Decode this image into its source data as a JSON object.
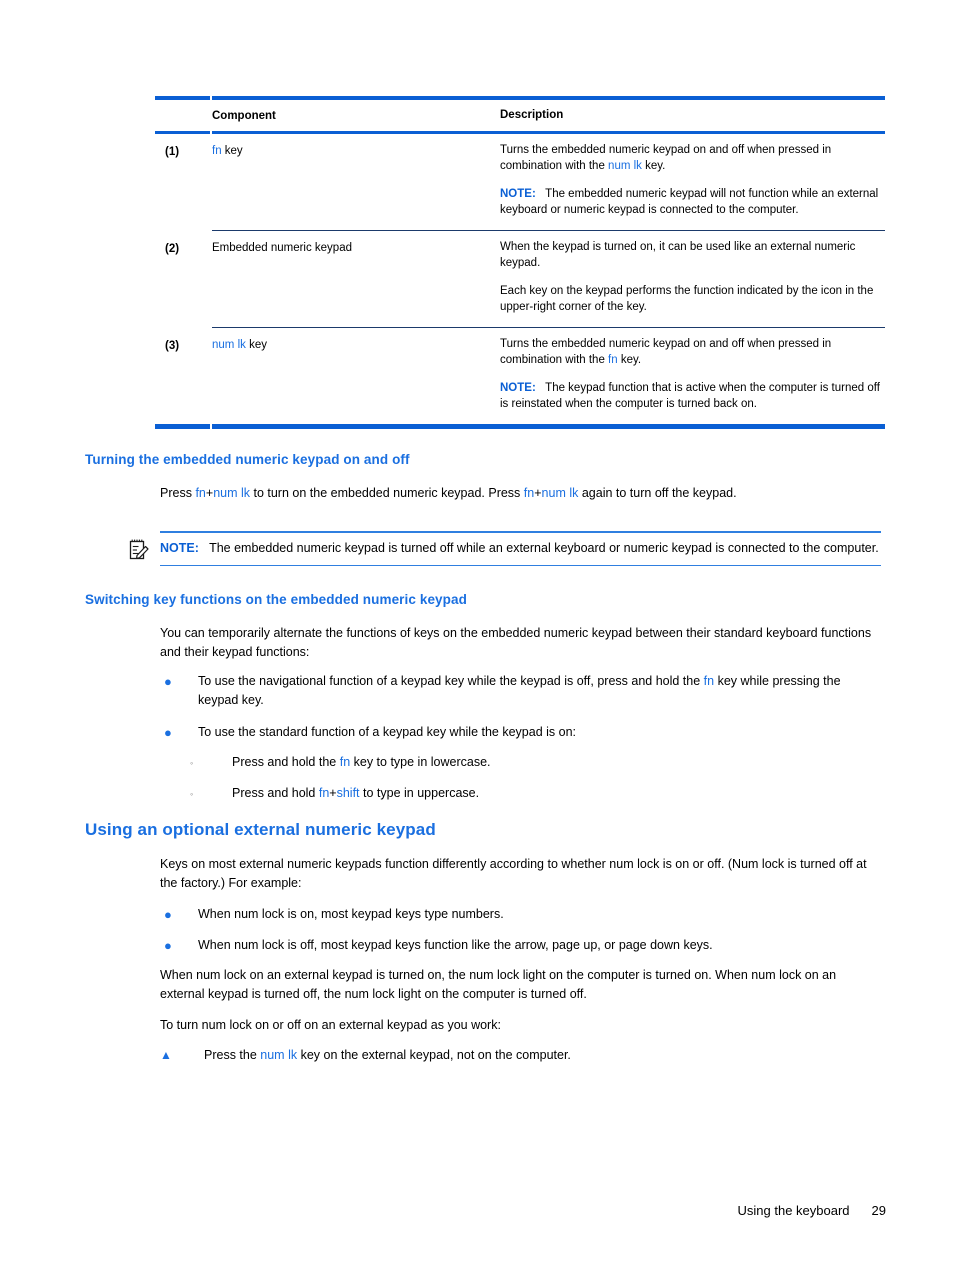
{
  "table": {
    "headers": {
      "component": "Component",
      "description": "Description"
    },
    "rows": [
      {
        "num": "(1)",
        "component_pre": "",
        "component_kw": "fn",
        "component_post": " key",
        "desc_paras": [
          {
            "pre": "Turns the embedded numeric keypad on and off when pressed in combination with the ",
            "kw": "num lk",
            "post": " key."
          }
        ],
        "note_label": "NOTE:",
        "note_text": "The embedded numeric keypad will not function while an external keyboard or numeric keypad is connected to the computer."
      },
      {
        "num": "(2)",
        "component_pre": "Embedded numeric keypad",
        "component_kw": "",
        "component_post": "",
        "desc_paras": [
          {
            "pre": "When the keypad is turned on, it can be used like an external numeric keypad.",
            "kw": "",
            "post": ""
          },
          {
            "pre": "Each key on the keypad performs the function indicated by the icon in the upper-right corner of the key.",
            "kw": "",
            "post": ""
          }
        ],
        "note_label": "",
        "note_text": ""
      },
      {
        "num": "(3)",
        "component_pre": "",
        "component_kw": "num lk",
        "component_post": " key",
        "desc_paras": [
          {
            "pre": "Turns the embedded numeric keypad on and off when pressed in combination with the ",
            "kw": "fn",
            "post": " key."
          }
        ],
        "note_label": "NOTE:",
        "note_text": "The keypad function that is active when the computer is turned off is reinstated when the computer is turned back on."
      }
    ]
  },
  "section_turning": {
    "heading": "Turning the embedded numeric keypad on and off",
    "para": {
      "t1": "Press ",
      "kw1": "fn",
      "plus1": "+",
      "kw2": "num lk",
      "t2": " to turn on the embedded numeric keypad. Press ",
      "kw3": "fn",
      "plus2": "+",
      "kw4": "num lk",
      "t3": " again to turn off the keypad."
    },
    "note": {
      "label": "NOTE:",
      "text": "The embedded numeric keypad is turned off while an external keyboard or numeric keypad is connected to the computer.",
      "icon": "note-pencil-icon"
    }
  },
  "section_switching": {
    "heading": "Switching key functions on the embedded numeric keypad",
    "intro": "You can temporarily alternate the functions of keys on the embedded numeric keypad between their standard keyboard functions and their keypad functions:",
    "bullet_glyph": "●",
    "subbullet_glyph": "◦",
    "bullets": [
      {
        "pre": "To use the navigational function of a keypad key while the keypad is off, press and hold the ",
        "kw": "fn",
        "post": " key while pressing the keypad key."
      },
      {
        "pre": "To use the standard function of a keypad key while the keypad is on:",
        "kw": "",
        "post": ""
      }
    ],
    "subbullets": [
      {
        "pre": "Press and hold the ",
        "kw": "fn",
        "mid": "",
        "kw2": "",
        "post": " key to type in lowercase."
      },
      {
        "pre": "Press and hold ",
        "kw": "fn",
        "mid": "+",
        "kw2": "shift",
        "post": " to type in uppercase."
      }
    ]
  },
  "section_external": {
    "heading": "Using an optional external numeric keypad",
    "intro": "Keys on most external numeric keypads function differently according to whether num lock is on or off. (Num lock is turned off at the factory.) For example:",
    "bullets": [
      "When num lock is on, most keypad keys type numbers.",
      "When num lock is off, most keypad keys function like the arrow, page up, or page down keys."
    ],
    "para2": "When num lock on an external keypad is turned on, the num lock light on the computer is turned on. When num lock on an external keypad is turned off, the num lock light on the computer is turned off.",
    "para3": "To turn num lock on or off on an external keypad as you work:",
    "triangle_glyph": "▲",
    "final": {
      "pre": "Press the ",
      "kw": "num lk",
      "post": " key on the external keypad, not on the computer."
    }
  },
  "footer": {
    "title": "Using the keyboard",
    "page": "29"
  },
  "colors": {
    "link_blue": "#1a6fe0",
    "rule_blue": "#0a5fd4",
    "row_rule": "#1b3a6b",
    "text": "#000000"
  }
}
